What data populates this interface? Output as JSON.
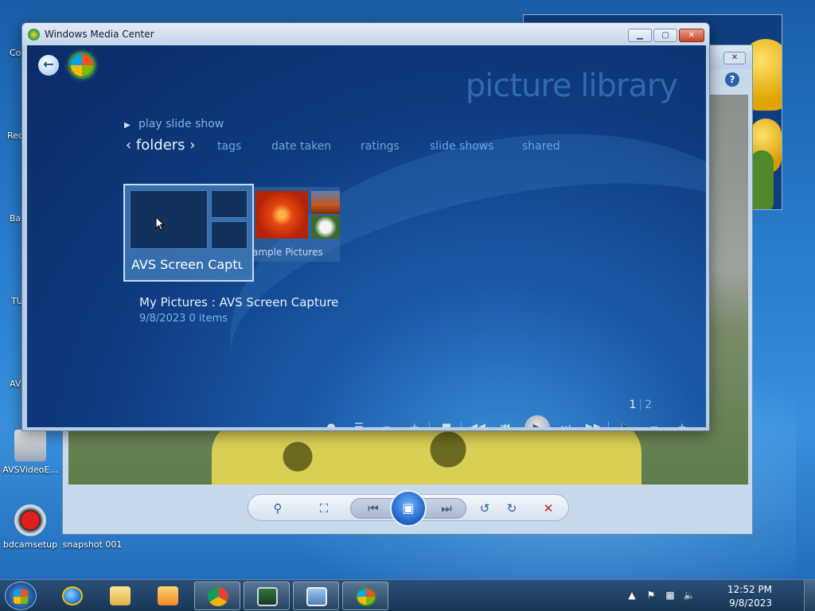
{
  "desktop": {
    "icons": [
      {
        "label": "bdcamsetup"
      },
      {
        "label": "snapshot 001"
      },
      {
        "label": "AVSVideoE..."
      }
    ],
    "partial_labels": [
      "Co",
      "Rec",
      "Ba",
      "TU",
      "AV"
    ]
  },
  "photo_viewer": {
    "close_label": "✕",
    "help_label": "?"
  },
  "wmc": {
    "window_title": "Windows Media Center",
    "controls": {
      "minimize": "▁",
      "maximize": "▢",
      "close": "✕"
    },
    "heading": "picture library",
    "play_slide_show": "play slide show",
    "nav": {
      "active": "folders",
      "items": [
        "tags",
        "date taken",
        "ratings",
        "slide shows",
        "shared"
      ]
    },
    "tiles": [
      {
        "label": "AVS Screen Capture"
      },
      {
        "label": "ample Pictures"
      }
    ],
    "detail": {
      "title": "My Pictures : AVS Screen Capture",
      "meta": "9/8/2023   0 items"
    },
    "pager": {
      "current": "1",
      "separator": "|",
      "other": "2"
    }
  },
  "taskbar": {
    "time": "12:52 PM",
    "date": "9/8/2023"
  },
  "icons": {
    "back": "back-arrow-icon",
    "start": "windows-logo-icon"
  }
}
